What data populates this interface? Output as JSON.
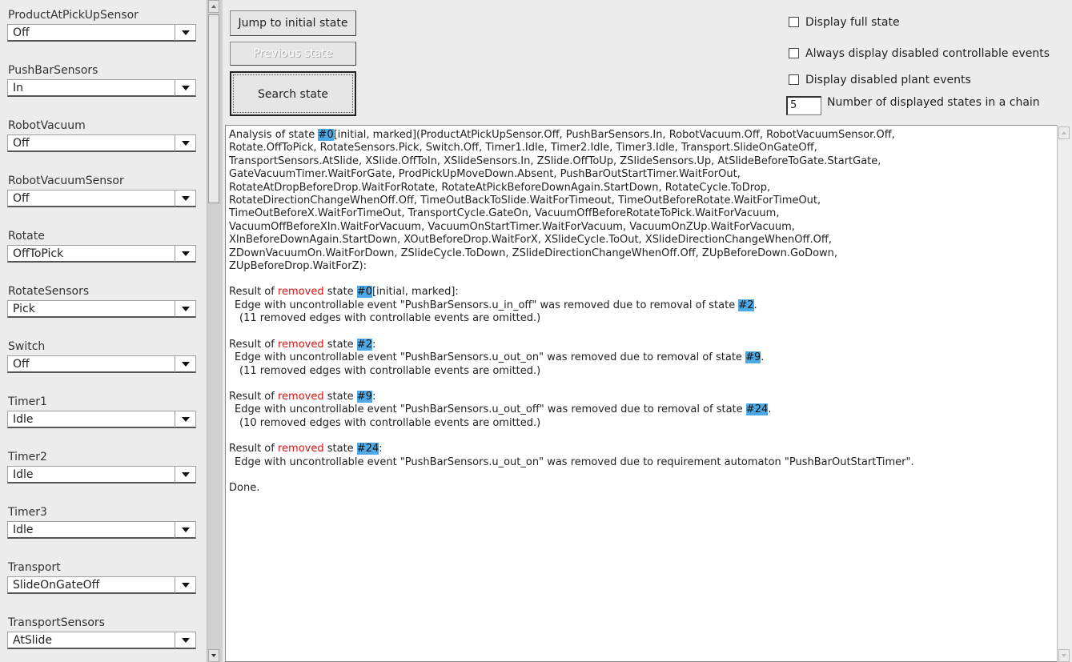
{
  "sidebar": {
    "variables": [
      {
        "label": "ProductAtPickUpSensor",
        "value": "Off"
      },
      {
        "label": "PushBarSensors",
        "value": "In"
      },
      {
        "label": "RobotVacuum",
        "value": "Off"
      },
      {
        "label": "RobotVacuumSensor",
        "value": "Off"
      },
      {
        "label": "Rotate",
        "value": "OffToPick"
      },
      {
        "label": "RotateSensors",
        "value": "Pick"
      },
      {
        "label": "Switch",
        "value": "Off"
      },
      {
        "label": "Timer1",
        "value": "Idle"
      },
      {
        "label": "Timer2",
        "value": "Idle"
      },
      {
        "label": "Timer3",
        "value": "Idle"
      },
      {
        "label": "Transport",
        "value": "SlideOnGateOff"
      },
      {
        "label": "TransportSensors",
        "value": "AtSlide"
      }
    ]
  },
  "buttons": {
    "jump": "Jump to initial state",
    "previous": "Previous state",
    "search": "Search state"
  },
  "options": {
    "display_full_state": "Display full state",
    "always_display_disabled": "Always display disabled controllable events",
    "display_disabled_plant": "Display disabled plant events",
    "chain_count_value": "5",
    "chain_count_label": "Number of displayed states in a chain"
  },
  "output": {
    "analysis": {
      "prefix": "Analysis of state ",
      "state": "#0",
      "lines": [
        "[initial, marked](ProductAtPickUpSensor.Off, PushBarSensors.In, RobotVacuum.Off, RobotVacuumSensor.Off,",
        "Rotate.OffToPick, RotateSensors.Pick, Switch.Off, Timer1.Idle, Timer2.Idle, Timer3.Idle, Transport.SlideOnGateOff,",
        "TransportSensors.AtSlide, XSlide.OffToIn, XSlideSensors.In, ZSlide.OffToUp, ZSlideSensors.Up, AtSlideBeforeToGate.StartGate,",
        "GateVacuumTimer.WaitForGate, ProdPickUpMoveDown.Absent, PushBarOutStartTimer.WaitForOut,",
        "RotateAtDropBeforeDrop.WaitForRotate, RotateAtPickBeforeDownAgain.StartDown, RotateCycle.ToDrop,",
        "RotateDirectionChangeWhenOff.Off, TimeOutBackToSlide.WaitForTimeout, TimeOutBeforeRotate.WaitForTimeOut,",
        "TimeOutBeforeX.WaitForTimeOut, TransportCycle.GateOn, VacuumOffBeforeRotateToPick.WaitForVacuum,",
        "VacuumOffBeforeXIn.WaitForVacuum, VacuumOnStartTimer.WaitForVacuum, VacuumOnZUp.WaitForVacuum,",
        "XInBeforeDownAgain.StartDown, XOutBeforeDrop.WaitForX, XSlideCycle.ToOut, XSlideDirectionChangeWhenOff.Off,",
        "ZDownVacuumOn.WaitForDown, ZSlideCycle.ToDown, ZSlideDirectionChangeWhenOff.Off, ZUpBeforeDown.GoDown,",
        "ZUpBeforeDrop.WaitForZ):"
      ]
    },
    "results": [
      {
        "result_of": "Result of ",
        "removed": "removed",
        "state_word": " state ",
        "state": "#0",
        "suffix": "[initial, marked]:",
        "edge_text": "Edge with uncontrollable event \"PushBarSensors.u_in_off\" was removed due to removal of state ",
        "edge_state": "#2",
        "edge_end": ".",
        "note": "(11 removed edges with controllable events are omitted.)"
      },
      {
        "result_of": "Result of ",
        "removed": "removed",
        "state_word": " state ",
        "state": "#2",
        "suffix": ":",
        "edge_text": "Edge with uncontrollable event \"PushBarSensors.u_out_on\" was removed due to removal of state ",
        "edge_state": "#9",
        "edge_end": ".",
        "note": "(11 removed edges with controllable events are omitted.)"
      },
      {
        "result_of": "Result of ",
        "removed": "removed",
        "state_word": " state ",
        "state": "#9",
        "suffix": ":",
        "edge_text": "Edge with uncontrollable event \"PushBarSensors.u_out_off\" was removed due to removal of state ",
        "edge_state": "#24",
        "edge_end": ".",
        "note": "(10 removed edges with controllable events are omitted.)"
      },
      {
        "result_of": "Result of ",
        "removed": "removed",
        "state_word": " state ",
        "state": "#24",
        "suffix": ":",
        "edge_text": "Edge with uncontrollable event \"PushBarSensors.u_out_on\" was removed due to requirement automaton \"PushBarOutStartTimer\".",
        "edge_state": "",
        "edge_end": "",
        "note": ""
      }
    ],
    "done": "Done."
  },
  "colors": {
    "highlight": "#4da8e6",
    "removed": "#e01010",
    "background": "#ececec"
  }
}
